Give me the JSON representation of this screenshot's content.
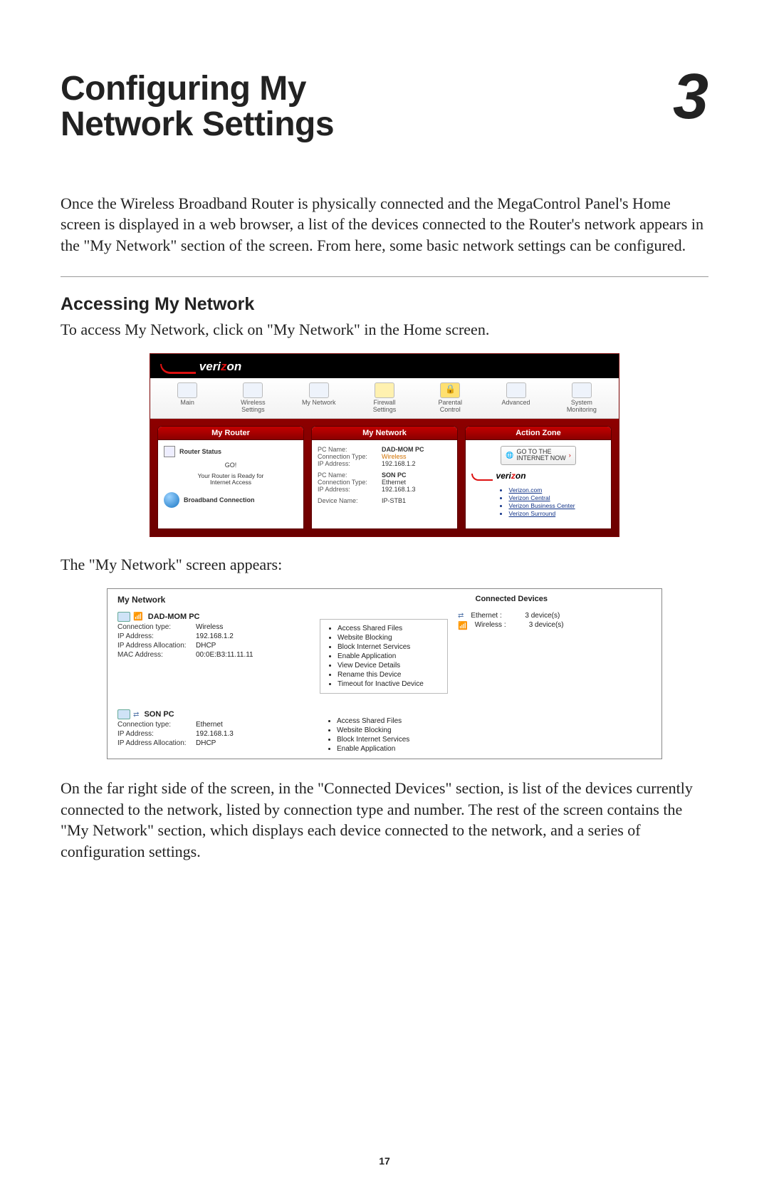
{
  "chapter": {
    "title_line1": "Configuring My",
    "title_line2": "Network Settings",
    "number": "3"
  },
  "intro": "Once the Wireless Broadband Router is physically connected and the MegaControl Panel's Home screen is displayed in a web browser, a list of the devices connected to the Router's network appears in the \"My Network\" section of the screen. From here, some basic network settings can be configured.",
  "section": {
    "title": "Accessing My Network",
    "lead": "To access My Network, click on \"My Network\" in the Home screen."
  },
  "fig1": {
    "logo_text_a": "veri",
    "logo_text_b": "z",
    "logo_text_c": "on",
    "toolbar": [
      "Main",
      "Wireless\nSettings",
      "My Network",
      "Firewall\nSettings",
      "Parental\nControl",
      "Advanced",
      "System\nMonitoring"
    ],
    "panels": {
      "router": {
        "title": "My Router",
        "status_label": "Router Status",
        "go": "GO!",
        "ready": "Your Router is Ready for\nInternet Access",
        "bb_label": "Broadband Connection"
      },
      "network": {
        "title": "My Network",
        "entries": [
          {
            "name_label": "PC Name:",
            "name": "DAD-MOM PC",
            "ct_label": "Connection Type:",
            "ct": "Wireless",
            "ip_label": "IP Address:",
            "ip": "192.168.1.2"
          },
          {
            "name_label": "PC Name:",
            "name": "SON PC",
            "ct_label": "Connection Type:",
            "ct": "Ethernet",
            "ip_label": "IP Address:",
            "ip": "192.168.1.3"
          },
          {
            "name_label": "Device Name:",
            "name": "IP-STB1"
          }
        ]
      },
      "action": {
        "title": "Action Zone",
        "goto": "GO TO THE\nINTERNET NOW",
        "links": [
          "Verizon.com",
          "Verizon Central",
          "Verizon Business Center",
          "Verizon Surround"
        ]
      }
    }
  },
  "between1": "The \"My Network\" screen appears:",
  "fig2": {
    "title": "My Network",
    "connected_title": "Connected Devices",
    "devices": [
      {
        "name": "DAD-MOM PC",
        "rows": [
          {
            "k": "Connection type:",
            "v": "Wireless"
          },
          {
            "k": "IP Address:",
            "v": "192.168.1.2"
          },
          {
            "k": "IP Address Allocation:",
            "v": "DHCP"
          },
          {
            "k": "MAC Address:",
            "v": "00:0E:B3:11.11.11"
          }
        ],
        "actions": [
          "Access Shared Files",
          "Website Blocking",
          "Block Internet Services",
          "Enable Application",
          "View Device Details",
          "Rename this Device",
          "Timeout for Inactive Device"
        ]
      },
      {
        "name": "SON PC",
        "rows": [
          {
            "k": "Connection type:",
            "v": "Ethernet"
          },
          {
            "k": "IP Address:",
            "v": "192.168.1.3"
          },
          {
            "k": "IP Address Allocation:",
            "v": "DHCP"
          }
        ],
        "actions": [
          "Access Shared Files",
          "Website Blocking",
          "Block Internet Services",
          "Enable Application"
        ]
      }
    ],
    "counts": [
      {
        "label": "Ethernet :",
        "value": "3 device(s)"
      },
      {
        "label": "Wireless :",
        "value": "3 device(s)"
      }
    ]
  },
  "closing": "On the far right side of the screen, in the \"Connected Devices\" section, is list of the devices currently connected to the network, listed by connection type and number. The rest of the screen contains the \"My Network\" section, which displays each device connected to the network, and a series of configuration settings.",
  "page_number": "17"
}
